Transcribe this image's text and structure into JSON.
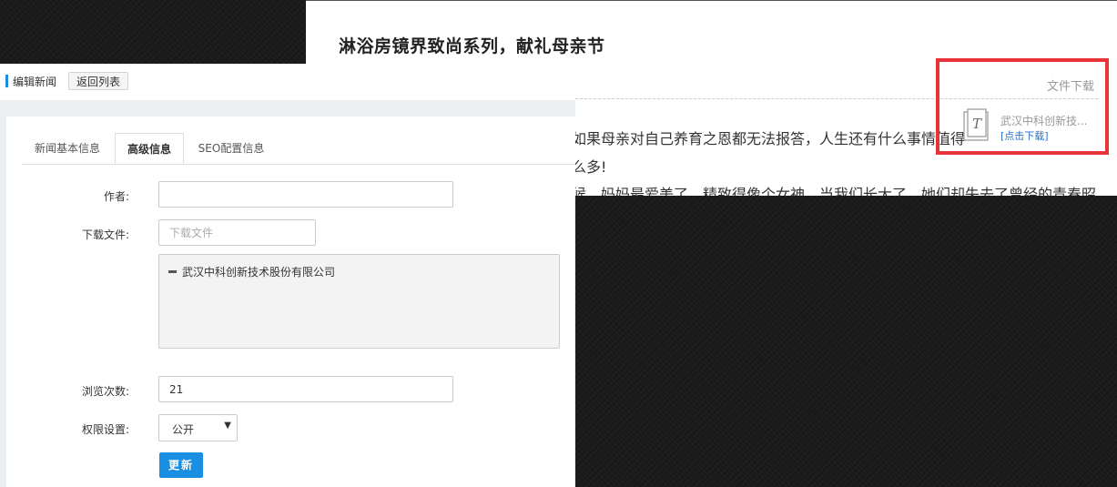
{
  "article": {
    "title": "淋浴房镜界致尚系列，献礼母亲节",
    "para1": "如果母亲对自己养育之恩都无法报答，人生还有什么事情值得",
    "para2": "么多!",
    "para3": "候，妈妈最爱美了，精致得像个女神。当我们长大了，她们却失去了曾经的青春昭"
  },
  "download": {
    "title": "文件下载",
    "file_name": "武汉中科创新技...",
    "link_text": "[点击下载]",
    "icon_glyph": "T",
    "highlight_color": "#e8333a"
  },
  "toolbar": {
    "label": "编辑新闻",
    "back_button": "返回列表"
  },
  "tabs": [
    "新闻基本信息",
    "高级信息",
    "SEO配置信息"
  ],
  "form": {
    "author_label": "作者:",
    "author_value": "",
    "file_label": "下载文件:",
    "file_placeholder": "下载文件",
    "tree_item": "武汉中科创新技术股份有限公司",
    "views_label": "浏览次数:",
    "views_value": "21",
    "permission_label": "权限设置:",
    "permission_value": "公开",
    "submit_label": "更新"
  },
  "colors": {
    "accent": "#1a8ee1",
    "link": "#2a6fc9"
  }
}
